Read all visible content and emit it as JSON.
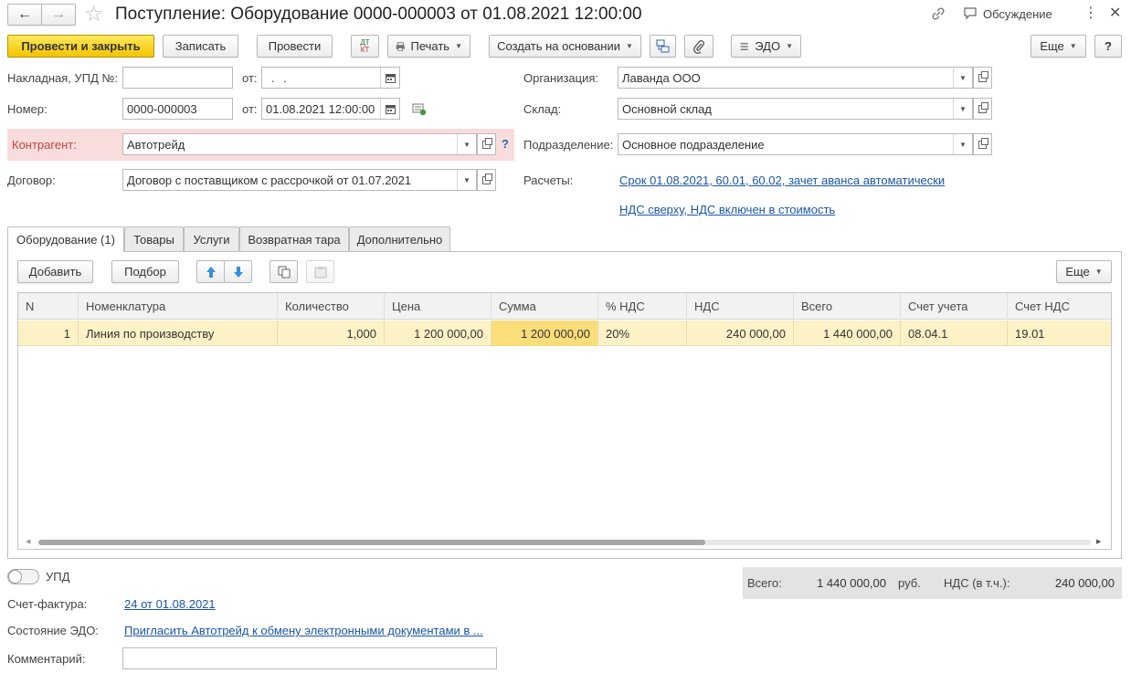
{
  "window": {
    "title": "Поступление: Оборудование 0000-000003 от 01.08.2021 12:00:00",
    "discuss_label": "Обсуждение"
  },
  "toolbar": {
    "post_close": "Провести и закрыть",
    "save": "Записать",
    "post": "Провести",
    "dt_kt_top": "ДТ",
    "dt_kt_bottom": "КТ",
    "print": "Печать",
    "create_based": "Создать на основании",
    "edo": "ЭДО",
    "more": "Еще",
    "help": "?"
  },
  "form": {
    "invoice_label": "Накладная, УПД №:",
    "invoice_value": "",
    "from_label": "от:",
    "invoice_date": " .  .",
    "number_label": "Номер:",
    "number_value": "0000-000003",
    "from_label2": "от:",
    "number_date": "01.08.2021 12:00:00",
    "counterparty_label": "Контрагент:",
    "counterparty_value": "Автотрейд",
    "counterparty_help": "?",
    "contract_label": "Договор:",
    "contract_value": "Договор с поставщиком с рассрочкой от 01.07.2021",
    "org_label": "Организация:",
    "org_value": "Лаванда ООО",
    "warehouse_label": "Склад:",
    "warehouse_value": "Основной склад",
    "division_label": "Подразделение:",
    "division_value": "Основное подразделение",
    "settlements_label": "Расчеты:",
    "settlements_link": "Срок 01.08.2021, 60.01, 60.02, зачет аванса автоматически",
    "vat_link": "НДС сверху, НДС включен в стоимость"
  },
  "tabs": [
    {
      "label": "Оборудование (1)"
    },
    {
      "label": "Товары"
    },
    {
      "label": "Услуги"
    },
    {
      "label": "Возвратная тара"
    },
    {
      "label": "Дополнительно"
    }
  ],
  "table_toolbar": {
    "add": "Добавить",
    "pick": "Подбор",
    "more": "Еще"
  },
  "table": {
    "columns": [
      "N",
      "Номенклатура",
      "Количество",
      "Цена",
      "Сумма",
      "% НДС",
      "НДС",
      "Всего",
      "Счет учета",
      "Счет НДС"
    ],
    "rows": [
      {
        "n": "1",
        "item": "Линия по производству",
        "qty": "1,000",
        "price": "1 200 000,00",
        "sum": "1 200 000,00",
        "vat_rate": "20%",
        "vat": "240 000,00",
        "total": "1 440 000,00",
        "account": "08.04.1",
        "vat_account": "19.01"
      }
    ]
  },
  "footer": {
    "upd_label": "УПД",
    "invoice_label": "Счет-фактура:",
    "invoice_link": "24 от 01.08.2021",
    "edo_label": "Состояние ЭДО:",
    "edo_link": "Пригласить Автотрейд к обмену электронными документами в ...",
    "comment_label": "Комментарий:",
    "comment_value": "",
    "total_label": "Всего:",
    "total_value": "1 440 000,00",
    "currency": "руб.",
    "vat_label": "НДС (в т.ч.):",
    "vat_value": "240 000,00"
  },
  "colors": {
    "primary_button": "#f3c400",
    "counterparty_highlight": "#f9dcdc",
    "selected_row": "#fdf1c6",
    "selected_cell": "#fbdd7a",
    "link": "#1a56a6",
    "arrow_blue": "#3a8fd8"
  }
}
